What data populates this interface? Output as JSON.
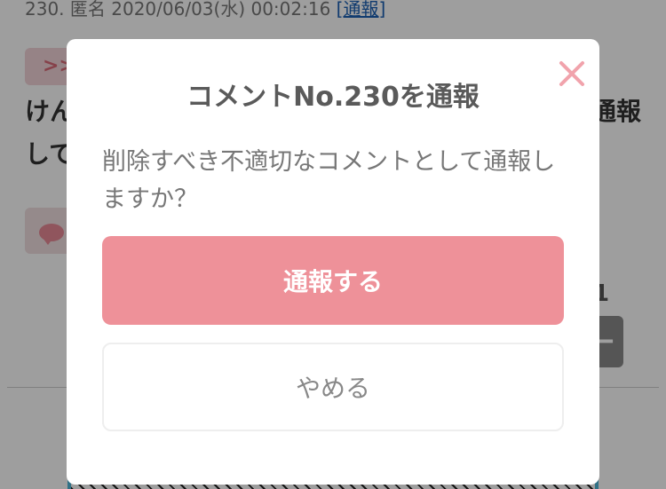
{
  "background": {
    "comment_header": {
      "text": "230. 匿名 2020/06/03(水) 00:02:16 ",
      "report_link": "[通報]"
    },
    "reply_chip": ">>",
    "body": {
      "line1": "けん",
      "line1_right": "通報",
      "line2": "して"
    },
    "count": "1",
    "minus_label": "−"
  },
  "modal": {
    "title": "コメントNo.230を通報",
    "message": "削除すべき不適切なコメントとして通報しますか？",
    "report_button": "通報する",
    "cancel_button": "やめる",
    "close_icon": "close-icon",
    "colors": {
      "primary": "#ee9199",
      "close": "#f1a3ac",
      "overlay": "rgba(0,0,0,0.38)"
    }
  }
}
